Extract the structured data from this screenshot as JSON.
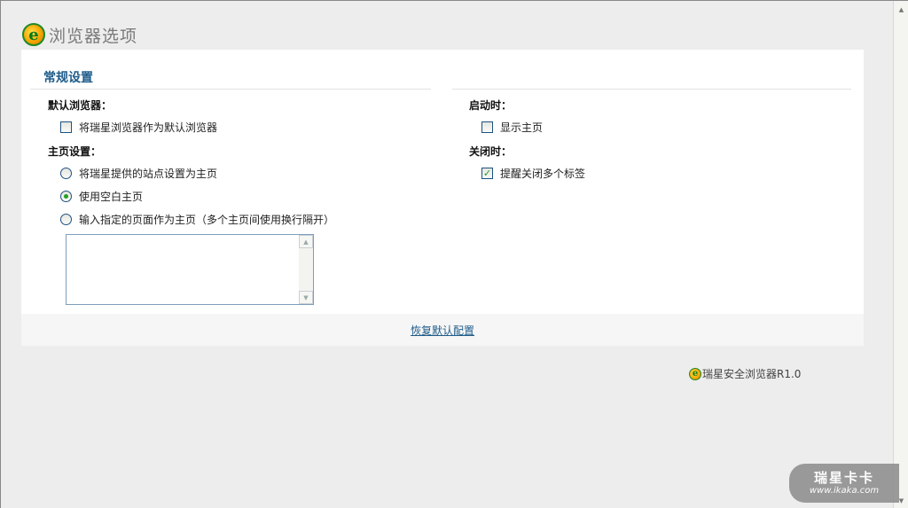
{
  "header": {
    "title": "浏览器选项",
    "logo_icon": "browser-logo-icon"
  },
  "panel": {
    "section_title": "常规设置",
    "default_browser": {
      "label": "默认浏览器：",
      "checkbox_label": "将瑞星浏览器作为默认浏览器",
      "checked": false
    },
    "homepage": {
      "label": "主页设置：",
      "options": [
        {
          "label": "将瑞星提供的站点设置为主页",
          "selected": false
        },
        {
          "label": "使用空白主页",
          "selected": true
        },
        {
          "label": "输入指定的页面作为主页（多个主页间使用换行隔开）",
          "selected": false
        }
      ],
      "textarea_value": ""
    },
    "startup": {
      "label": "启动时：",
      "checkbox_label": "显示主页",
      "checked": false
    },
    "on_close": {
      "label": "关闭时：",
      "checkbox_label": "提醒关闭多个标签",
      "checked": true
    }
  },
  "footer": {
    "restore_link": "恢复默认配置"
  },
  "version": {
    "text": "瑞星安全浏览器R1.0"
  },
  "watermark": {
    "line1": "瑞星卡卡",
    "line2": "www.ikaka.com"
  },
  "colors": {
    "accent": "#1f5c8a",
    "check": "#21a121",
    "page_bg": "#ededed"
  }
}
